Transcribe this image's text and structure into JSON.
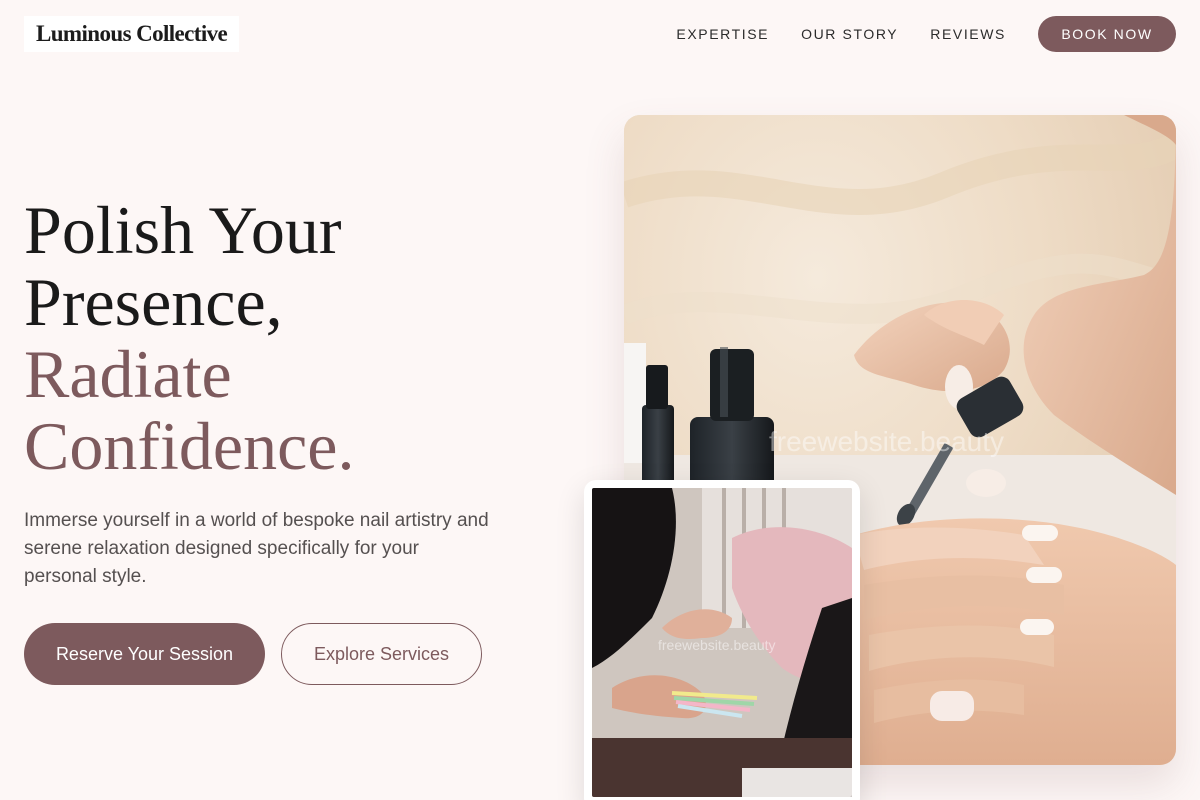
{
  "header": {
    "logo": "Luminous Collective",
    "nav": [
      "EXPERTISE",
      "OUR STORY",
      "REVIEWS"
    ],
    "cta": "BOOK NOW"
  },
  "hero": {
    "title_line1": "Polish Your",
    "title_line2": "Presence,",
    "title_line3": "Radiate",
    "title_line4": "Confidence.",
    "subtitle": "Immerse yourself in a world of bespoke nail artistry and serene relaxation designed specifically for your personal style.",
    "primary_button": "Reserve Your Session",
    "secondary_button": "Explore Services"
  },
  "images": {
    "main_watermark": "freewebsite.beauty",
    "inset_watermark": "freewebsite.beauty"
  },
  "colors": {
    "accent": "#7d5a5d",
    "background": "#fdf7f6",
    "text": "#1a1a1a"
  }
}
